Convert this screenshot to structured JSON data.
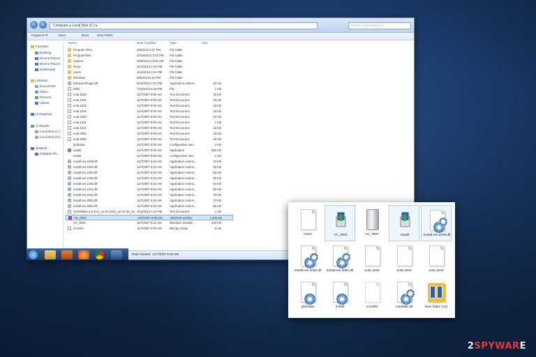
{
  "explorer": {
    "address": "Computer ▸ Local Disk (C:) ▸",
    "search_placeholder": "Search Local Disk (C:)",
    "toolbar": [
      "Organize ▾",
      "Open",
      "Burn",
      "New folder"
    ],
    "nav": [
      "Favorites",
      "Desktop",
      "Recent Places",
      "Recent Places",
      "Downloads",
      "Libraries",
      "Documents",
      "Music",
      "Pictures",
      "Videos",
      "Homegroup",
      "Computer",
      "Local Disk (C:)",
      "Local Disk (D:)",
      "Network",
      "OWNER-PC"
    ],
    "columns": [
      "Name",
      "Date modified",
      "Type",
      "Size"
    ],
    "files": [
      {
        "name": "Program Files",
        "date": "3/8/2013 2:37 PM",
        "type": "File folder",
        "size": ""
      },
      {
        "name": "ProgramFiles",
        "date": "10/28/2012 3:01 PM",
        "type": "File folder",
        "size": ""
      },
      {
        "name": "System",
        "date": "3/28/2012 10:00 AM",
        "type": "File folder",
        "size": ""
      },
      {
        "name": "Temp",
        "date": "4/13/2013 1:04 PM",
        "type": "File folder",
        "size": ""
      },
      {
        "name": "Users",
        "date": "4/13/2013 1:04 PM",
        "type": "File folder",
        "size": ""
      },
      {
        "name": "Windows",
        "date": "3/8/2013 6:12 PM",
        "type": "File folder",
        "size": ""
      },
      {
        "name": "ElGamesPlugin.dll",
        "date": "8/10/2012 4:01 PM",
        "type": "Application extens...",
        "size": "40 KB"
      },
      {
        "name": "END",
        "date": "7/22/2013 8:15 PM",
        "type": "File",
        "size": "1 KB"
      },
      {
        "name": "eula.1028",
        "date": "11/7/2007 8:00 AM",
        "type": "Text Document",
        "size": "18 KB"
      },
      {
        "name": "eula.1031",
        "date": "11/7/2007 8:00 AM",
        "type": "Text Document",
        "size": "18 KB"
      },
      {
        "name": "eula.1033",
        "date": "11/7/2007 8:00 AM",
        "type": "Text Document",
        "size": "18 KB"
      },
      {
        "name": "eula.1036",
        "date": "11/7/2007 8:00 AM",
        "type": "Text Document",
        "size": "18 KB"
      },
      {
        "name": "eula.1040",
        "date": "11/7/2007 8:00 AM",
        "type": "Text Document",
        "size": "18 KB"
      },
      {
        "name": "eula.1041",
        "date": "11/7/2007 8:00 AM",
        "type": "Text Document",
        "size": "1 KB"
      },
      {
        "name": "eula.1042",
        "date": "11/7/2007 8:00 AM",
        "type": "Text Document",
        "size": "18 KB"
      },
      {
        "name": "eula.2052",
        "date": "11/7/2007 8:00 AM",
        "type": "Text Document",
        "size": "18 KB"
      },
      {
        "name": "eula.3082",
        "date": "11/7/2007 8:00 AM",
        "type": "Text Document",
        "size": "18 KB"
      },
      {
        "name": "globdata",
        "date": "11/7/2007 8:00 AM",
        "type": "Configuration sett...",
        "size": "2 KB"
      },
      {
        "name": "install",
        "date": "11/7/2007 8:00 AM",
        "type": "Application",
        "size": "550 KB"
      },
      {
        "name": "install",
        "date": "11/7/2007 8:00 AM",
        "type": "Configuration sett...",
        "size": "1 KB"
      },
      {
        "name": "install.res.1028.dll",
        "date": "11/7/2007 8:03 AM",
        "type": "Application extens...",
        "size": "73 KB"
      },
      {
        "name": "install.res.1031.dll",
        "date": "11/7/2007 8:03 AM",
        "type": "Application extens...",
        "size": "93 KB"
      },
      {
        "name": "install.res.1033.dll",
        "date": "11/7/2007 8:03 AM",
        "type": "Application extens...",
        "size": "90 KB"
      },
      {
        "name": "install.res.1036.dll",
        "date": "11/7/2007 8:03 AM",
        "type": "Application extens...",
        "size": "95 KB"
      },
      {
        "name": "install.res.1040.dll",
        "date": "11/7/2007 8:03 AM",
        "type": "Application extens...",
        "size": "84 KB"
      },
      {
        "name": "install.res.1041.dll",
        "date": "11/7/2007 8:03 AM",
        "type": "Application extens...",
        "size": "80 KB"
      },
      {
        "name": "install.res.1042.dll",
        "date": "11/7/2007 8:03 AM",
        "type": "Application extens...",
        "size": "75 KB"
      },
      {
        "name": "install.res.2052.dll",
        "date": "11/7/2007 8:03 AM",
        "type": "Application extens...",
        "size": "73 KB"
      },
      {
        "name": "install.res.3082.dll",
        "date": "11/7/2007 8:03 AM",
        "type": "Application extens...",
        "size": "95 KB"
      },
      {
        "name": "TDSSKiller.2.8.16.0_12.04.2013_16.42.35_log",
        "date": "4/12/2013 4:44 PM",
        "type": "Text Document",
        "size": "1 KB"
      },
      {
        "name": "VC_RED",
        "date": "11/7/2007 8:09 AM",
        "type": "WinRAR archive",
        "size": "1,409 KB",
        "selected": true
      },
      {
        "name": "VC_RED",
        "date": "11/7/2007 8:12 AM",
        "type": "Windows Installer ...",
        "size": "236 KB"
      },
      {
        "name": "vcredist",
        "date": "11/7/2007 8:00 AM",
        "type": "Bitmap image",
        "size": "6 KB"
      }
    ],
    "status": {
      "name": "VC_RED",
      "kind": "WinRAR archive",
      "modified": "Date modified: 11/7/2007 8:09 AM",
      "created": "Date created: 11/7/2007 8:09 AM",
      "size": "Size: 1.37 MB"
    }
  },
  "panel": {
    "items": [
      {
        "label": "reses",
        "icon": "document-icon"
      },
      {
        "label": "VC_RED",
        "icon": "installer-icon"
      },
      {
        "label": "VC_RED",
        "icon": "server-icon"
      },
      {
        "label": "install",
        "icon": "installer-icon"
      },
      {
        "label": "install.res.1028.dll",
        "icon": "dll-gear-icon"
      },
      {
        "label": "install.res.2052.dll",
        "icon": "dll-gear-icon"
      },
      {
        "label": "install.res.3082.dll",
        "icon": "dll-gear-icon"
      },
      {
        "label": "eula.1028",
        "icon": "document-icon"
      },
      {
        "label": "eula.1031",
        "icon": "document-icon"
      },
      {
        "label": "eula.1033",
        "icon": "document-icon"
      },
      {
        "label": "globdata",
        "icon": "config-gear-icon"
      },
      {
        "label": "install",
        "icon": "config-gear-icon"
      },
      {
        "label": "vcredist",
        "icon": "bitmap-icon"
      },
      {
        "label": "msdia80.dll",
        "icon": "dll-gear-icon"
      },
      {
        "label": "New folder (12)",
        "icon": "folder-icon"
      }
    ]
  },
  "watermark": {
    "prefix": "2",
    "brand": "SPYWAR",
    "suffix": "E"
  }
}
